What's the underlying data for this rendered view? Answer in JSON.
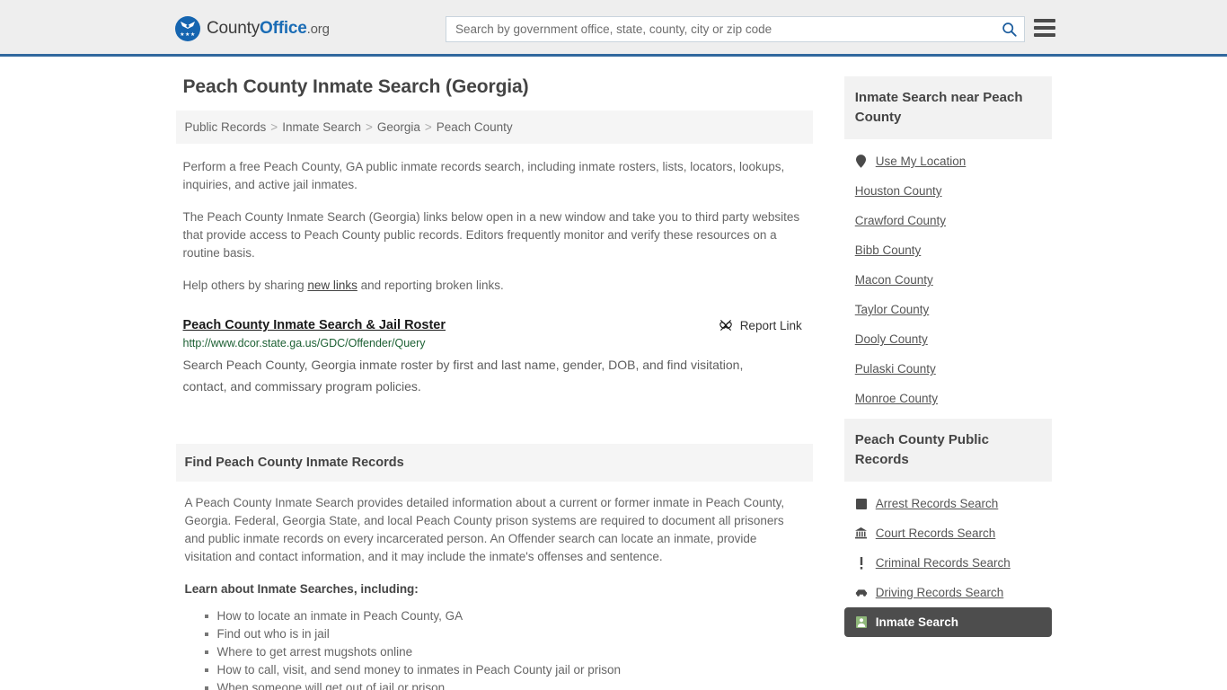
{
  "header": {
    "logo": {
      "part1": "County",
      "part2": "Office",
      "part3": ".org",
      "icon": "eagle-shield-icon"
    },
    "search": {
      "placeholder": "Search by government office, state, county, city or zip code",
      "value": "",
      "icon": "search-icon"
    },
    "menu_icon": "hamburger-menu-icon",
    "accent_color": "#31689e",
    "background_color": "#eeeeee"
  },
  "page": {
    "title": "Peach County Inmate Search (Georgia)"
  },
  "breadcrumb": {
    "items": [
      {
        "label": "Public Records"
      },
      {
        "label": "Inmate Search"
      },
      {
        "label": "Georgia"
      },
      {
        "label": "Peach County"
      }
    ],
    "separator": ">"
  },
  "intro": {
    "p1": "Perform a free Peach County, GA public inmate records search, including inmate rosters, lists, locators, lookups, inquiries, and active jail inmates.",
    "p2": "The Peach County Inmate Search (Georgia) links below open in a new window and take you to third party websites that provide access to Peach County public records. Editors frequently monitor and verify these resources on a routine basis.",
    "p3_before": "Help others by sharing ",
    "p3_link": "new links",
    "p3_after": " and reporting broken links."
  },
  "result": {
    "title": "Peach County Inmate Search & Jail Roster",
    "url": "http://www.dcor.state.ga.us/GDC/Offender/Query",
    "description": "Search Peach County, Georgia inmate roster by first and last name, gender, DOB, and find visitation, contact, and commissary program policies.",
    "report_label": "Report Link",
    "report_icon": "broken-link-icon",
    "url_color": "#1d6134"
  },
  "section": {
    "heading": "Find Peach County Inmate Records",
    "paragraph": "A Peach County Inmate Search provides detailed information about a current or former inmate in Peach County, Georgia. Federal, Georgia State, and local Peach County prison systems are required to document all prisoners and public inmate records on every incarcerated person. An Offender search can locate an inmate, provide visitation and contact information, and it may include the inmate's offenses and sentence.",
    "learn_heading": "Learn about Inmate Searches, including:",
    "bullets": [
      "How to locate an inmate in Peach County, GA",
      "Find out who is in jail",
      "Where to get arrest mugshots online",
      "How to call, visit, and send money to inmates in Peach County jail or prison",
      "When someone will get out of jail or prison"
    ]
  },
  "sidebar": {
    "nearby": {
      "heading": "Inmate Search near Peach County",
      "items": [
        {
          "label": "Use My Location",
          "icon": "map-pin-icon"
        },
        {
          "label": "Houston County",
          "icon": ""
        },
        {
          "label": "Crawford County",
          "icon": ""
        },
        {
          "label": "Bibb County",
          "icon": ""
        },
        {
          "label": "Macon County",
          "icon": ""
        },
        {
          "label": "Taylor County",
          "icon": ""
        },
        {
          "label": "Dooly County",
          "icon": ""
        },
        {
          "label": "Pulaski County",
          "icon": ""
        },
        {
          "label": "Monroe County",
          "icon": ""
        }
      ]
    },
    "public_records": {
      "heading": "Peach County Public Records",
      "items": [
        {
          "label": "Arrest Records Search",
          "icon": "fingerprint-icon",
          "active": false
        },
        {
          "label": "Court Records Search",
          "icon": "courthouse-icon",
          "active": false
        },
        {
          "label": "Criminal Records Search",
          "icon": "exclamation-icon",
          "active": false
        },
        {
          "label": "Driving Records Search",
          "icon": "car-icon",
          "active": false
        },
        {
          "label": "Inmate Search",
          "icon": "inmate-icon",
          "active": true
        }
      ],
      "active_background": "#4d4d4d"
    }
  }
}
